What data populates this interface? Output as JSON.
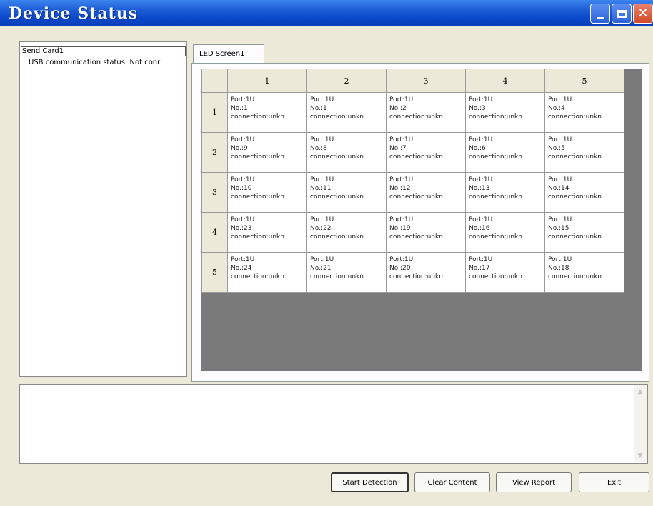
{
  "window": {
    "title": "Device Status",
    "controls": {
      "minimize": "minimize-icon",
      "maximize": "maximize-icon",
      "close": "close-icon"
    }
  },
  "tree": {
    "root_label": "Send Card1",
    "child_label": "USB communication status: Not conr"
  },
  "tabs": [
    {
      "label": "LED Screen1",
      "active": true
    }
  ],
  "grid": {
    "columns": [
      "1",
      "2",
      "3",
      "4",
      "5"
    ],
    "rows": [
      {
        "label": "1",
        "cells": [
          {
            "port": "Port:1U",
            "no": "No.:1",
            "conn": "connection:unkn"
          },
          {
            "port": "Port:1U",
            "no": "No.:1",
            "conn": "connection:unkn"
          },
          {
            "port": "Port:1U",
            "no": "No.:2",
            "conn": "connection:unkn"
          },
          {
            "port": "Port:1U",
            "no": "No.:3",
            "conn": "connection:unkn"
          },
          {
            "port": "Port:1U",
            "no": "No.:4",
            "conn": "connection:unkn"
          }
        ]
      },
      {
        "label": "2",
        "cells": [
          {
            "port": "Port:1U",
            "no": "No.:9",
            "conn": "connection:unkn"
          },
          {
            "port": "Port:1U",
            "no": "No.:8",
            "conn": "connection:unkn"
          },
          {
            "port": "Port:1U",
            "no": "No.:7",
            "conn": "connection:unkn"
          },
          {
            "port": "Port:1U",
            "no": "No.:6",
            "conn": "connection:unkn"
          },
          {
            "port": "Port:1U",
            "no": "No.:5",
            "conn": "connection:unkn"
          }
        ]
      },
      {
        "label": "3",
        "cells": [
          {
            "port": "Port:1U",
            "no": "No.:10",
            "conn": "connection:unkn"
          },
          {
            "port": "Port:1U",
            "no": "No.:11",
            "conn": "connection:unkn"
          },
          {
            "port": "Port:1U",
            "no": "No.:12",
            "conn": "connection:unkn"
          },
          {
            "port": "Port:1U",
            "no": "No.:13",
            "conn": "connection:unkn"
          },
          {
            "port": "Port:1U",
            "no": "No.:14",
            "conn": "connection:unkn"
          }
        ]
      },
      {
        "label": "4",
        "cells": [
          {
            "port": "Port:1U",
            "no": "No.:23",
            "conn": "connection:unkn"
          },
          {
            "port": "Port:1U",
            "no": "No.:22",
            "conn": "connection:unkn"
          },
          {
            "port": "Port:1U",
            "no": "No.:19",
            "conn": "connection:unkn"
          },
          {
            "port": "Port:1U",
            "no": "No.:16",
            "conn": "connection:unkn"
          },
          {
            "port": "Port:1U",
            "no": "No.:15",
            "conn": "connection:unkn"
          }
        ]
      },
      {
        "label": "5",
        "cells": [
          {
            "port": "Port:1U",
            "no": "No.:24",
            "conn": "connection:unkn"
          },
          {
            "port": "Port:1U",
            "no": "No.:21",
            "conn": "connection:unkn"
          },
          {
            "port": "Port:1U",
            "no": "No.:20",
            "conn": "connection:unkn"
          },
          {
            "port": "Port:1U",
            "no": "No.:17",
            "conn": "connection:unkn"
          },
          {
            "port": "Port:1U",
            "no": "No.:18",
            "conn": "connection:unkn"
          }
        ]
      }
    ]
  },
  "log": {
    "content": ""
  },
  "buttons": {
    "start": "Start Detection",
    "clear": "Clear Content",
    "report": "View Report",
    "exit": "Exit"
  },
  "colors": {
    "titlebar": "#0a48c8",
    "dialog_bg": "#ece9d8",
    "grid_bg": "#7a7a7a",
    "close_button": "#d04a2a"
  }
}
